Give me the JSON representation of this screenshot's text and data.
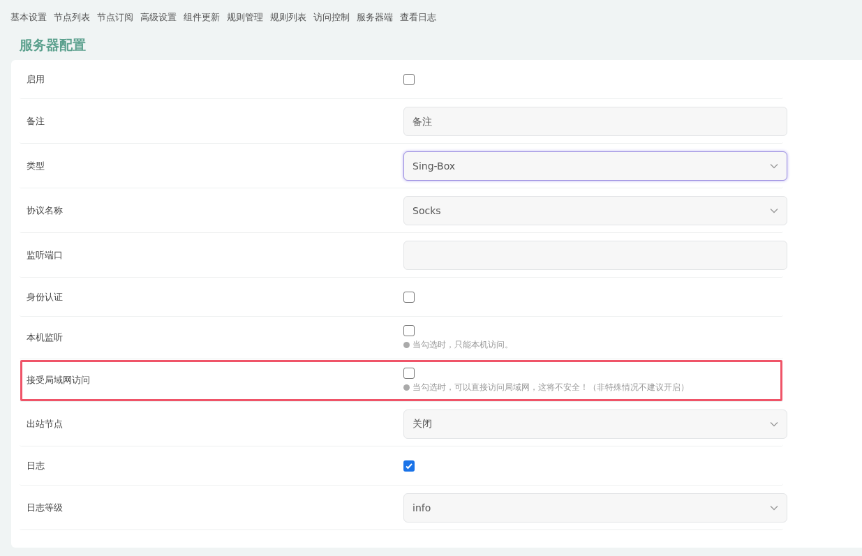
{
  "tabs": [
    {
      "label": "基本设置",
      "selected": false
    },
    {
      "label": "节点列表",
      "selected": false
    },
    {
      "label": "节点订阅",
      "selected": false
    },
    {
      "label": "高级设置",
      "selected": false
    },
    {
      "label": "组件更新",
      "selected": false
    },
    {
      "label": "规则管理",
      "selected": false
    },
    {
      "label": "规则列表",
      "selected": false
    },
    {
      "label": "访问控制",
      "selected": false
    },
    {
      "label": "服务器端",
      "selected": false
    },
    {
      "label": "查看日志",
      "selected": false
    }
  ],
  "heading": "服务器配置",
  "rows": [
    {
      "label": "启用",
      "kind": "checkbox",
      "checked": false,
      "highlighted": false
    },
    {
      "label": "备注",
      "kind": "text",
      "placeholder": "备注",
      "highlighted": false
    },
    {
      "label": "类型",
      "kind": "select",
      "value": "Sing-Box",
      "focused": true,
      "highlighted": false
    },
    {
      "label": "协议名称",
      "kind": "select",
      "value": "Socks",
      "focused": false,
      "highlighted": false
    },
    {
      "label": "监听端口",
      "kind": "text",
      "highlighted": false
    },
    {
      "label": "身份认证",
      "kind": "checkbox",
      "checked": false,
      "highlighted": false
    },
    {
      "label": "本机监听",
      "kind": "checkbox",
      "checked": false,
      "hint": "当勾选时，只能本机访问。",
      "highlighted": false
    },
    {
      "label": "接受局域网访问",
      "kind": "checkbox",
      "checked": false,
      "hint": "当勾选时，可以直接访问局域网，这将不安全！（非特殊情况不建议开启）",
      "highlighted": true
    },
    {
      "label": "出站节点",
      "kind": "select",
      "value": "关闭",
      "focused": false,
      "highlighted": false
    },
    {
      "label": "日志",
      "kind": "checkbox",
      "checked": true,
      "highlighted": false
    },
    {
      "label": "日志等级",
      "kind": "select",
      "value": "info",
      "focused": false,
      "highlighted": false
    }
  ]
}
